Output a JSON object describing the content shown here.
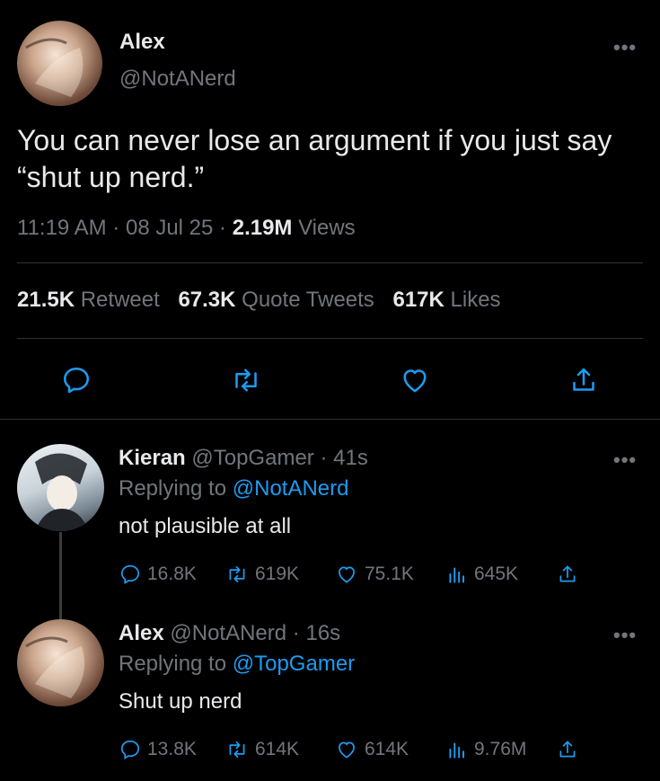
{
  "main_tweet": {
    "author_name": "Alex",
    "author_handle": "@NotANerd",
    "text": "You can never lose an argument if you just say “shut up nerd.”",
    "time": "11:19 AM",
    "sep1": "·",
    "date": "08 Jul 25",
    "sep2": "·",
    "views_count": "2.19M",
    "views_label": "Views",
    "retweets_count": "21.5K",
    "retweets_label": "Retweet",
    "quotes_count": "67.3K",
    "quotes_label": "Quote Tweets",
    "likes_count": "617K",
    "likes_label": "Likes"
  },
  "replies": [
    {
      "name": "Kieran",
      "handle": "@TopGamer",
      "sep": "·",
      "time": "41s",
      "replying_prefix": "Replying to",
      "replying_to": "@NotANerd",
      "text": "not plausible at all",
      "replies": "16.8K",
      "retweets": "619K",
      "likes": "75.1K",
      "views": "645K"
    },
    {
      "name": "Alex",
      "handle": "@NotANerd",
      "sep": "·",
      "time": "16s",
      "replying_prefix": "Replying to",
      "replying_to": "@TopGamer",
      "text": "Shut up nerd",
      "replies": "13.8K",
      "retweets": "614K",
      "likes": "614K",
      "views": "9.76M"
    }
  ],
  "more_label": "•••",
  "colors": {
    "background": "#000000",
    "text": "#e7e9ea",
    "muted": "#71767b",
    "link": "#1d9bf0",
    "divider": "#2f3336"
  },
  "icons": [
    "reply-icon",
    "retweet-icon",
    "like-icon",
    "share-icon",
    "views-icon",
    "more-icon"
  ]
}
